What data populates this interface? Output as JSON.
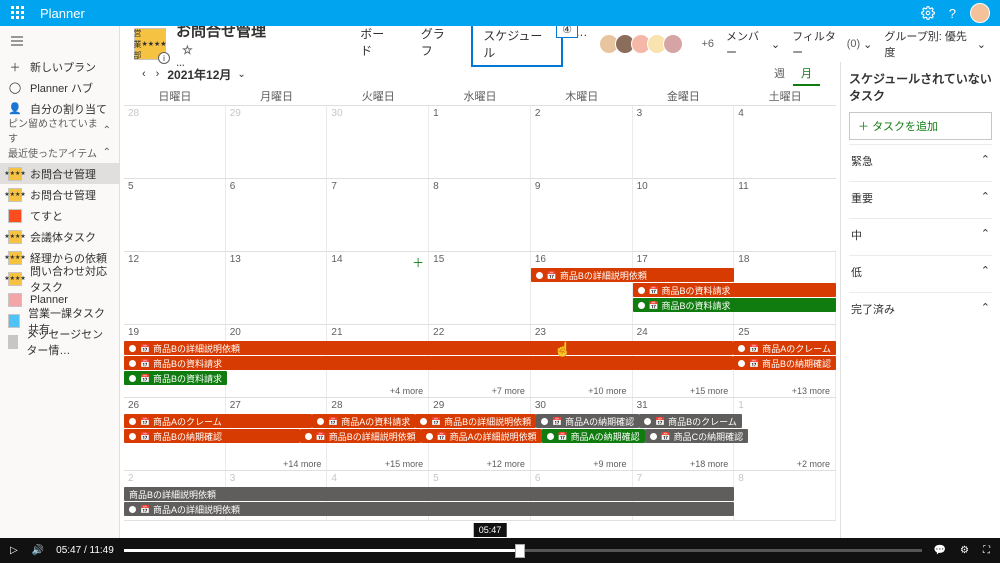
{
  "app": {
    "name": "Planner"
  },
  "nav": {
    "new_plan": "新しいプラン",
    "hub": "Planner ハブ",
    "my_tasks": "自分の割り当て",
    "pinned_section": "ピン留めされています",
    "recent_section": "最近使ったアイテム",
    "items": [
      "お問合せ管理",
      "お問合せ管理",
      "てすと",
      "会議体タスク",
      "経理からの依頼",
      "問い合わせ対応タスク",
      "Planner",
      "営業一課タスク共有",
      "メッセージセンター情…"
    ]
  },
  "plan": {
    "title": "お問合せ管理",
    "team_badge": "営業部",
    "views": {
      "board": "ボード",
      "chart": "グラフ",
      "schedule": "スケジュール"
    },
    "callout": "④",
    "avatars_extra": "+6",
    "menu_members": "メンバー",
    "menu_filter": "フィルター",
    "menu_filter_count": "(0)",
    "menu_group": "グループ別: 優先度"
  },
  "cal": {
    "month": "2021年12月",
    "mode_week": "週",
    "mode_month": "月",
    "dow": [
      "日曜日",
      "月曜日",
      "火曜日",
      "水曜日",
      "木曜日",
      "金曜日",
      "土曜日"
    ],
    "w1": [
      "28",
      "29",
      "30",
      "1",
      "2",
      "3",
      "4"
    ],
    "w2": [
      "5",
      "6",
      "7",
      "8",
      "9",
      "10",
      "11"
    ],
    "w3": [
      "12",
      "13",
      "14",
      "15",
      "16",
      "17",
      "18"
    ],
    "w4": [
      "19",
      "20",
      "21",
      "22",
      "23",
      "24",
      "25"
    ],
    "w5": [
      "26",
      "27",
      "28",
      "29",
      "30",
      "31",
      "1"
    ],
    "w6": [
      "2",
      "3",
      "4",
      "5",
      "6",
      "7",
      "8"
    ],
    "tasks": {
      "b_detail": "商品Bの詳細説明依頼",
      "b_mat": "商品Bの資料請求",
      "a_claim": "商品Aのクレーム",
      "a_confirm": "商品Aの納期確認",
      "b_confirm": "商品Bの納期確認",
      "a_mat": "商品Aの資料請求",
      "a_detail": "商品Aの詳細説明依頼",
      "b_claim": "商品Bのクレーム",
      "c_confirm": "商品Cの納期確認"
    },
    "more": {
      "w4": [
        "",
        "",
        "+4 more",
        "+7 more",
        "+10 more",
        "+15 more",
        "+13 more"
      ],
      "w5": [
        "",
        "+14 more",
        "+15 more",
        "+12 more",
        "+9 more",
        "+18 more",
        "+2 more"
      ]
    }
  },
  "right": {
    "header": "スケジュールされていないタスク",
    "add": "タスクを追加",
    "buckets": [
      "緊急",
      "重要",
      "中",
      "低",
      "完了済み"
    ]
  },
  "player": {
    "time": "05:47 / 11:49",
    "scrub": "05:47"
  }
}
